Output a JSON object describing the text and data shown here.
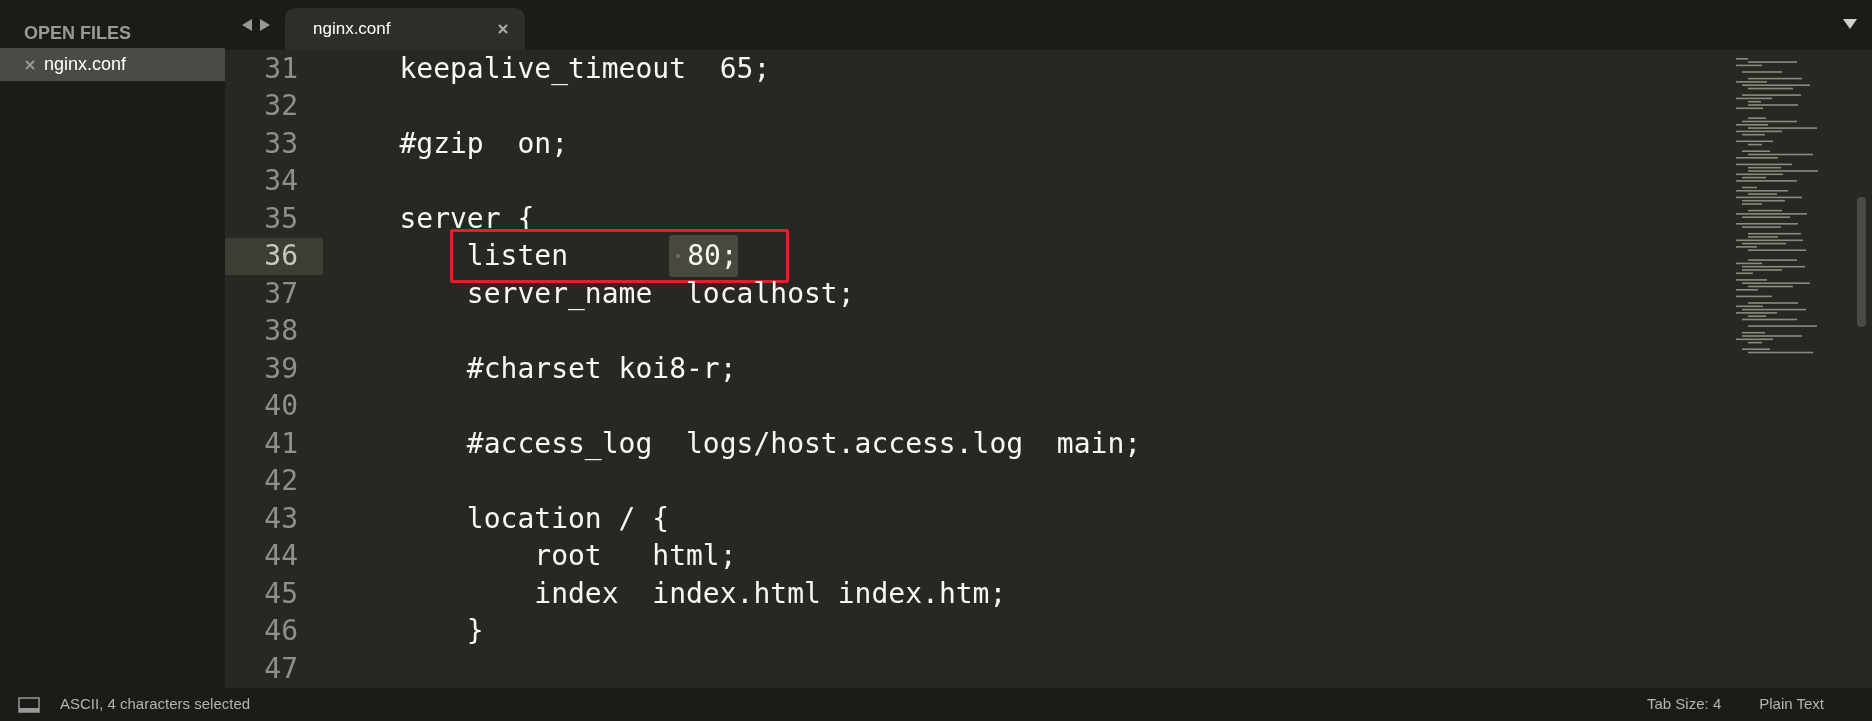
{
  "sidebar": {
    "title": "OPEN FILES",
    "files": [
      {
        "name": "nginx.conf",
        "selected": true
      }
    ]
  },
  "tabs": [
    {
      "label": "nginx.conf",
      "selected": true
    }
  ],
  "lines": [
    {
      "number": "31",
      "code": "    keepalive_timeout  65;",
      "current": false,
      "boxed": false
    },
    {
      "number": "32",
      "current": false,
      "boxed": false
    },
    {
      "number": "33",
      "code": "    #gzip  on;",
      "current": false,
      "boxed": false
    },
    {
      "number": "34",
      "current": false,
      "boxed": false
    },
    {
      "number": "35",
      "code": "    server {",
      "current": false,
      "boxed": false
    },
    {
      "number": "36",
      "code": "        listen      ",
      "selected_code": "80;",
      "current": true,
      "boxed": true
    },
    {
      "number": "37",
      "code": "        server_name  localhost;",
      "current": false,
      "boxed": false
    },
    {
      "number": "38",
      "current": false,
      "boxed": false
    },
    {
      "number": "39",
      "code": "        #charset koi8-r;",
      "current": false,
      "boxed": false
    },
    {
      "number": "40",
      "current": false,
      "boxed": false
    },
    {
      "number": "41",
      "code": "        #access_log  logs/host.access.log  main;",
      "current": false,
      "boxed": false
    },
    {
      "number": "42",
      "current": false,
      "boxed": false
    },
    {
      "number": "43",
      "code": "        location / {",
      "current": false,
      "boxed": false
    },
    {
      "number": "44",
      "code": "            root   html;",
      "current": false,
      "boxed": false
    },
    {
      "number": "45",
      "code": "            index  index.html index.htm;",
      "current": false,
      "boxed": false
    },
    {
      "number": "46",
      "code": "        }",
      "current": false,
      "boxed": false
    },
    {
      "number": "47",
      "current": false,
      "boxed": false
    }
  ],
  "status_bar": {
    "message": "ASCII, 4 characters selected",
    "tab_size": "Tab Size: 4",
    "syntax": "Plain Text"
  }
}
